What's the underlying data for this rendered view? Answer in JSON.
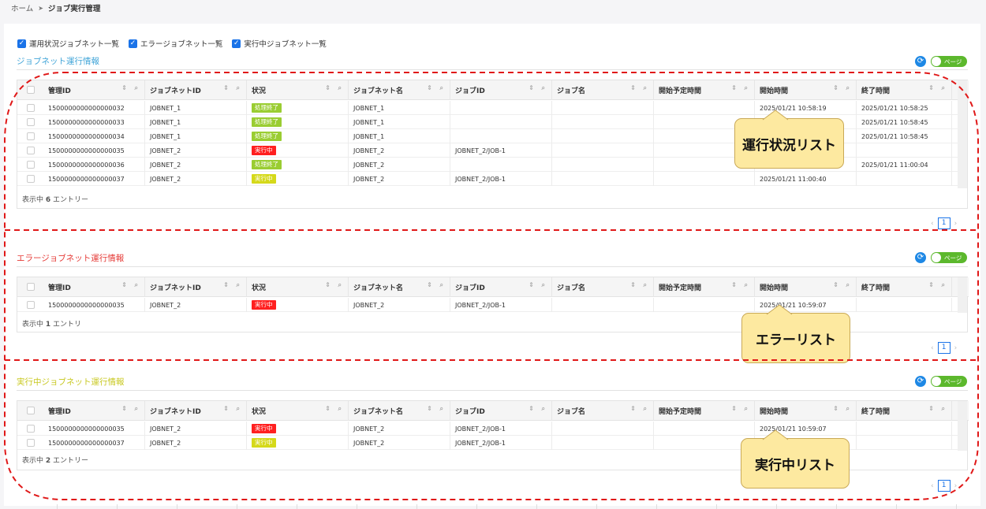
{
  "breadcrumb": {
    "home": "ホーム",
    "sep": "➤",
    "current": "ジョブ実行管理"
  },
  "filters": [
    {
      "label": "運用状況ジョブネット一覧",
      "checked": true
    },
    {
      "label": "エラージョブネット一覧",
      "checked": true
    },
    {
      "label": "実行中ジョブネット一覧",
      "checked": true
    }
  ],
  "columns": [
    "管理ID",
    "ジョブネットID",
    "状況",
    "ジョブネット名",
    "ジョブID",
    "ジョブ名",
    "開始予定時間",
    "開始時間",
    "終了時間"
  ],
  "toggle_label": "ページ",
  "colors": {
    "running": "#ff2020",
    "done": "#9acd32",
    "pending": "#d5d91a",
    "accent": "#1a73e8"
  },
  "sections": [
    {
      "title": "ジョブネット運行情報",
      "title_color": "#42a5d8",
      "footer_prefix": "表示中",
      "footer_count": "6",
      "footer_suffix": "エントリー",
      "page": "1",
      "callout": "運行状況リスト",
      "rows": [
        {
          "id": "1500000000000000032",
          "jobnet_id": "JOBNET_1",
          "status": "処理終了",
          "status_type": "done",
          "jobnet_name": "JOBNET_1",
          "job_id": "",
          "job_name": "",
          "planned": "",
          "start": "2025/01/21 10:58:19",
          "end": "2025/01/21 10:58:25"
        },
        {
          "id": "1500000000000000033",
          "jobnet_id": "JOBNET_1",
          "status": "処理終了",
          "status_type": "done",
          "jobnet_name": "JOBNET_1",
          "job_id": "",
          "job_name": "",
          "planned": "",
          "start": "",
          "end": "2025/01/21 10:58:45"
        },
        {
          "id": "1500000000000000034",
          "jobnet_id": "JOBNET_1",
          "status": "処理終了",
          "status_type": "done",
          "jobnet_name": "JOBNET_1",
          "job_id": "",
          "job_name": "",
          "planned": "",
          "start": "",
          "end": "2025/01/21 10:58:45"
        },
        {
          "id": "1500000000000000035",
          "jobnet_id": "JOBNET_2",
          "status": "実行中",
          "status_type": "running",
          "jobnet_name": "JOBNET_2",
          "job_id": "JOBNET_2/JOB-1",
          "job_name": "",
          "planned": "",
          "start": "",
          "end": ""
        },
        {
          "id": "1500000000000000036",
          "jobnet_id": "JOBNET_2",
          "status": "処理終了",
          "status_type": "done",
          "jobnet_name": "JOBNET_2",
          "job_id": "",
          "job_name": "",
          "planned": "",
          "start": "",
          "end": "2025/01/21 11:00:04"
        },
        {
          "id": "1500000000000000037",
          "jobnet_id": "JOBNET_2",
          "status": "実行中",
          "status_type": "pending",
          "jobnet_name": "JOBNET_2",
          "job_id": "JOBNET_2/JOB-1",
          "job_name": "",
          "planned": "",
          "start": "2025/01/21 11:00:40",
          "end": ""
        }
      ]
    },
    {
      "title": "エラージョブネット運行情報",
      "title_color": "#e53935",
      "footer_prefix": "表示中",
      "footer_count": "1",
      "footer_suffix": "エントリ",
      "page": "1",
      "callout": "エラーリスト",
      "rows": [
        {
          "id": "1500000000000000035",
          "jobnet_id": "JOBNET_2",
          "status": "実行中",
          "status_type": "running",
          "jobnet_name": "JOBNET_2",
          "job_id": "JOBNET_2/JOB-1",
          "job_name": "",
          "planned": "",
          "start": "2025/01/21 10:59:07",
          "end": ""
        }
      ]
    },
    {
      "title": "実行中ジョブネット運行情報",
      "title_color": "#c8c820",
      "footer_prefix": "表示中",
      "footer_count": "2",
      "footer_suffix": "エントリー",
      "page": "1",
      "callout": "実行中リスト",
      "rows": [
        {
          "id": "1500000000000000035",
          "jobnet_id": "JOBNET_2",
          "status": "実行中",
          "status_type": "running",
          "jobnet_name": "JOBNET_2",
          "job_id": "JOBNET_2/JOB-1",
          "job_name": "",
          "planned": "",
          "start": "2025/01/21 10:59:07",
          "end": ""
        },
        {
          "id": "1500000000000000037",
          "jobnet_id": "JOBNET_2",
          "status": "実行中",
          "status_type": "pending",
          "jobnet_name": "JOBNET_2",
          "job_id": "JOBNET_2/JOB-1",
          "job_name": "",
          "planned": "",
          "start": "",
          "end": ""
        }
      ]
    }
  ]
}
